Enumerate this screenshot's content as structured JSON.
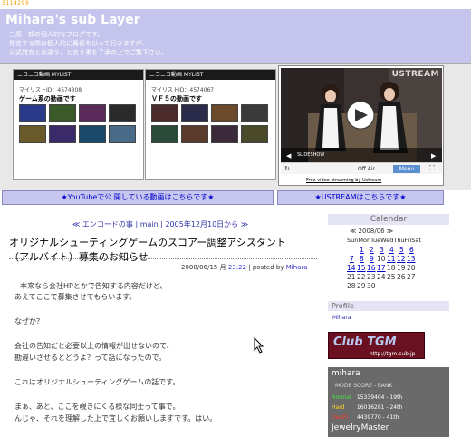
{
  "header": {
    "counter": "3114299",
    "title": "Mihara's sub Layer",
    "intro": [
      "三原一郎の個人的なブログです。",
      "発言する際は個人的に責任を以って行きますが、",
      "公式発言とは違う、と言う事を了承の上でご覧下さい。"
    ]
  },
  "nico_lists": [
    {
      "brand": "ニコニコ動画 MYLIST",
      "id_label": "マイリストID：4574308",
      "title": "ゲーム系の動画です",
      "thumb_colors": [
        "#2a3a8a",
        "#3a5a2a",
        "#5a2a5a",
        "#2a2a2a",
        "#6a5a2a",
        "#3a2a6a",
        "#1a4a6a",
        "#4a6a8a"
      ]
    },
    {
      "brand": "ニコニコ動画 MYLIST",
      "id_label": "マイリストID：4574067",
      "title": "ＶＦ５の動画です",
      "thumb_colors": [
        "#4a2a2a",
        "#2a2a4a",
        "#6a4a2a",
        "#3a3a3a",
        "#2a4a3a",
        "#5a3a2a",
        "#3a2a3a",
        "#4a4a2a"
      ]
    }
  ],
  "ustream": {
    "logo": "USTREAM",
    "slideshow": "SLIDESHOW",
    "status": "Off Air",
    "menu": "Menu",
    "free_link": "Free video streaming by Ustream"
  },
  "links": {
    "youtube": "★YouTubeで公 開している動画はこちらです★",
    "ustream": "★USTREAMはこちらです★"
  },
  "post": {
    "nav": "≪ エンコードの事 | main | 2005年12月10日から ≫",
    "title": "オリジナルシューティングゲームのスコアー調整アシスタント（アルバイト）募集のお知らせ",
    "date": "2008/06/15 月",
    "time": "23:22",
    "posted_by": "| posted by",
    "author": "Mihara",
    "paragraphs": [
      "本来なら会社HPとかで告知する内容だけど、",
      "あえてここで募集させてもらいます。",
      "なぜか？",
      "会社の告知だと必要以上の情報が出せないので、",
      "勘違いさせるとどうよ？って話になったので。",
      "これはオリジナルシューティングゲームの話です。",
      "まぁ、あと、ここを覗きにくる様な同士って事で。",
      "んじゃ、それを理解した上で宜しくお願いしますです。はい。"
    ]
  },
  "calendar": {
    "title": "Calendar",
    "nav": "≪ 2008/06 ≫",
    "week": "SunMonTueWedThuFriSat",
    "rows": [
      [
        "",
        "1",
        "2",
        "3",
        "4",
        "5",
        "6"
      ],
      [
        "7",
        "8",
        "9",
        "10",
        "11",
        "12",
        "13"
      ],
      [
        "14",
        "15",
        "16",
        "17",
        "18",
        "19",
        "20"
      ],
      [
        "21",
        "22",
        "23",
        "24",
        "25",
        "26",
        "27"
      ],
      [
        "28",
        "29",
        "30",
        "",
        "",
        "",
        ""
      ]
    ],
    "linked": [
      "1",
      "2",
      "3",
      "4",
      "5",
      "6",
      "7",
      "8",
      "9",
      "11",
      "12",
      "13",
      "14",
      "15",
      "16",
      "17"
    ]
  },
  "profile": {
    "title": "Profile",
    "name": "Mihara"
  },
  "club_tgm": {
    "text": "Club TGM",
    "url": "http://tgm.sub.jp"
  },
  "score": {
    "name": "mihara",
    "head": "MODE     SCORE     - RANK",
    "rows": [
      {
        "mode": "Normal",
        "detail": "15339404 - 19th",
        "color": "#44dd44"
      },
      {
        "mode": "Hard",
        "detail": "16016281 - 24th",
        "color": "#ffdd22"
      },
      {
        "mode": "Death",
        "detail": "4439770 - 41th",
        "color": "#ff3333"
      }
    ],
    "footer": "JewelryMaster"
  }
}
